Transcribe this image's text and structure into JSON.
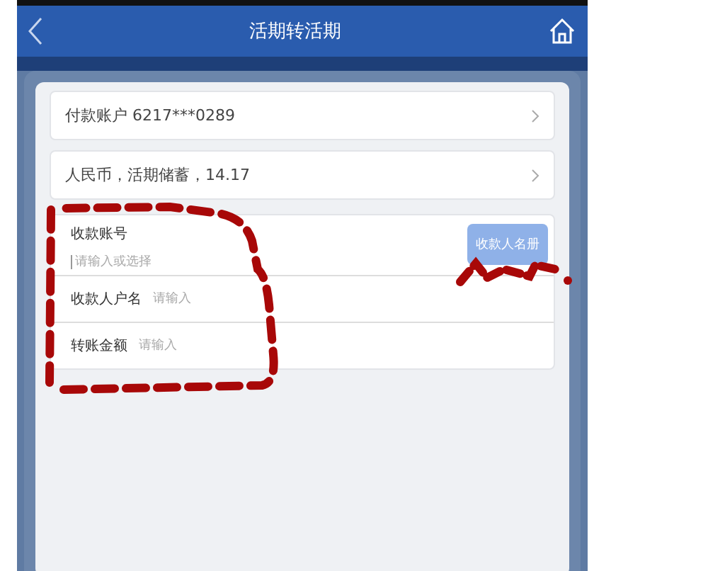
{
  "header": {
    "title": "活期转活期"
  },
  "account_rows": [
    {
      "text": "付款账户 6217***0289"
    },
    {
      "text": "人民币，活期储蓄，14.17"
    }
  ],
  "payee_form": {
    "account": {
      "label": "收款账号",
      "placeholder": "请输入或选择",
      "button": "收款人名册"
    },
    "fields": [
      {
        "label": "收款人户名",
        "placeholder": "请输入"
      },
      {
        "label": "转账金额",
        "placeholder": "请输入"
      }
    ]
  }
}
